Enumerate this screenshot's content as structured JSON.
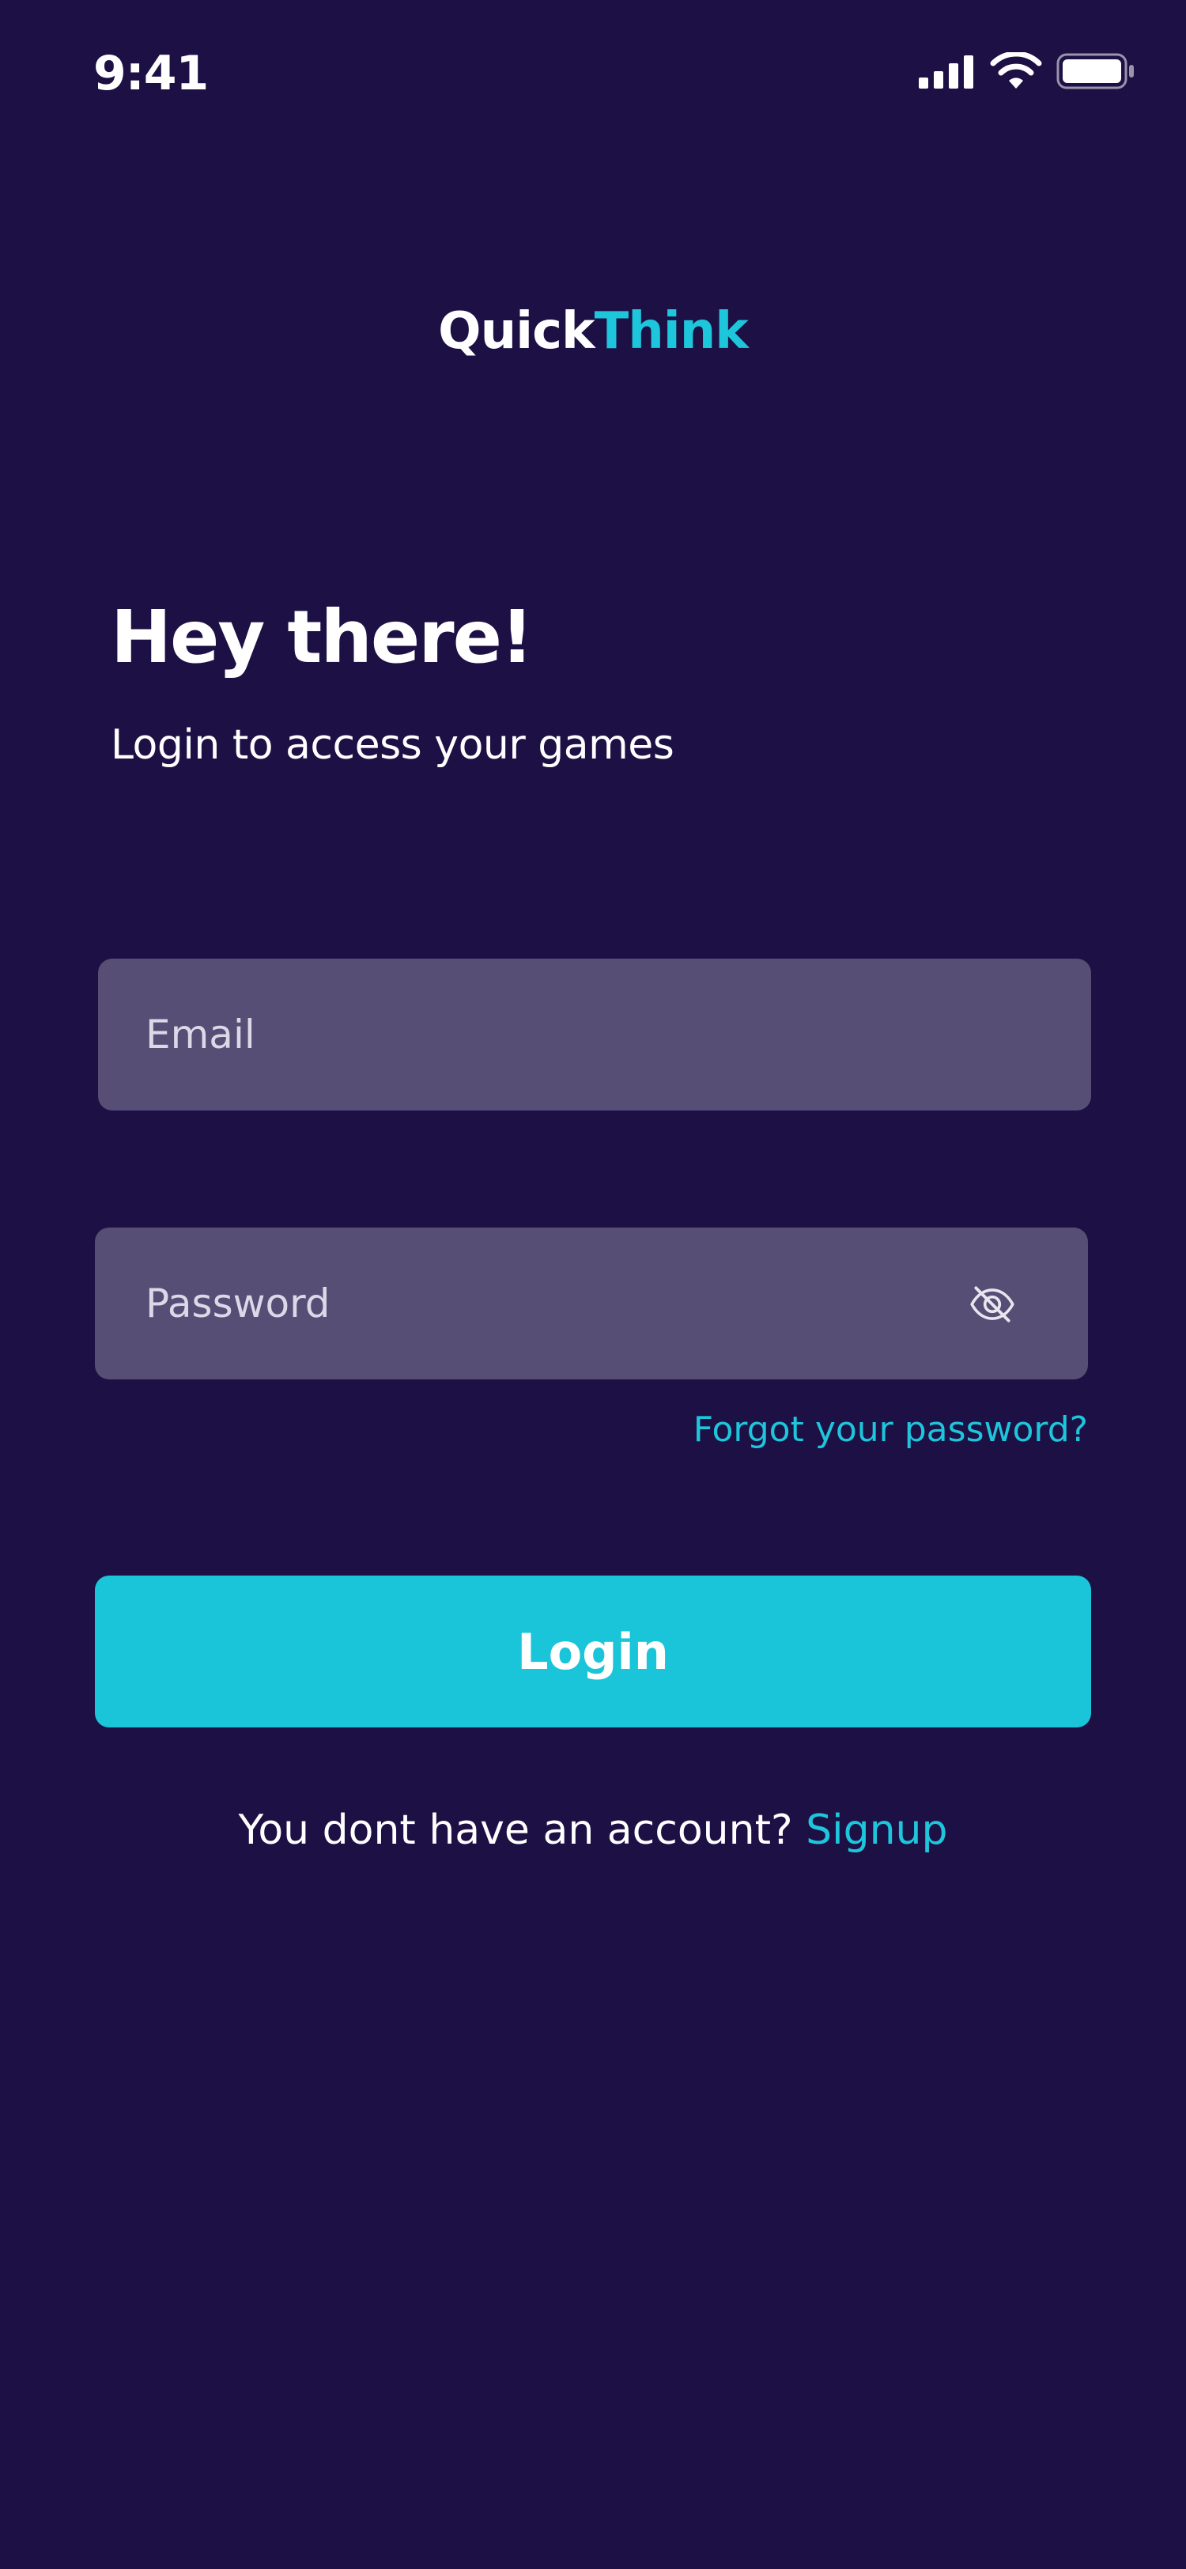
{
  "status_bar": {
    "time": "9:41",
    "icons": [
      "signal-icon",
      "wifi-icon",
      "battery-icon"
    ]
  },
  "logo": {
    "part1": "Quick",
    "part2": "Think"
  },
  "header": {
    "title": "Hey there!",
    "subtitle": "Login to access your games"
  },
  "form": {
    "email_placeholder": "Email",
    "email_value": "",
    "password_placeholder": "Password",
    "password_value": "",
    "toggle_icon": "eye-slash-icon",
    "forgot_label": "Forgot your password?",
    "login_label": "Login"
  },
  "signup": {
    "prompt": "You dont have an account?",
    "link_label": "Signup"
  },
  "colors": {
    "background": "#1d1045",
    "accent": "#1ac5d9",
    "input_bg": "#574e76",
    "text": "#ffffff"
  }
}
